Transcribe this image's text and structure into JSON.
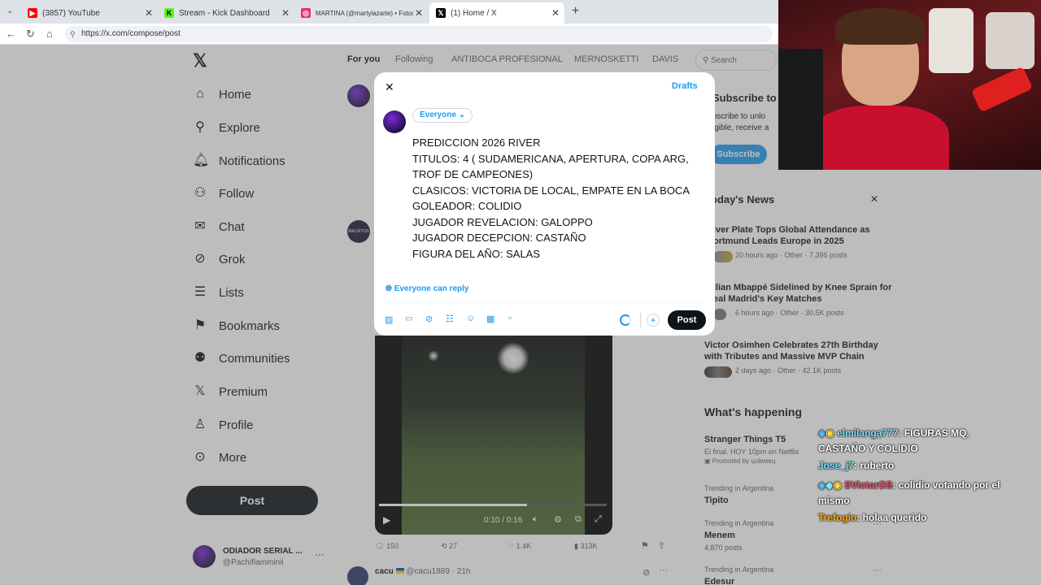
{
  "browser": {
    "tabs": [
      {
        "label": "(3857) YouTube",
        "icon": "youtube-icon",
        "color": "#ff0000"
      },
      {
        "label": "Stream - Kick Dashboard",
        "icon": "kick-icon",
        "color": "#53fc18"
      },
      {
        "label": "MARTINA (@martylazarte) • Fotos y",
        "icon": "instagram-icon",
        "color": "#e1306c"
      },
      {
        "label": "(1) Home / X",
        "icon": "x-icon",
        "color": "#000000"
      }
    ],
    "url": "https://x.com/compose/post"
  },
  "sidebar": {
    "items": [
      {
        "label": "Home",
        "icon": "home-icon"
      },
      {
        "label": "Explore",
        "icon": "search-icon"
      },
      {
        "label": "Notifications",
        "icon": "bell-icon"
      },
      {
        "label": "Follow",
        "icon": "follow-icon"
      },
      {
        "label": "Chat",
        "icon": "mail-icon"
      },
      {
        "label": "Grok",
        "icon": "grok-icon"
      },
      {
        "label": "Lists",
        "icon": "list-icon"
      },
      {
        "label": "Bookmarks",
        "icon": "bookmark-icon"
      },
      {
        "label": "Communities",
        "icon": "communities-icon"
      },
      {
        "label": "Premium",
        "icon": "x-icon"
      },
      {
        "label": "Profile",
        "icon": "person-icon"
      },
      {
        "label": "More",
        "icon": "more-icon"
      }
    ],
    "post_label": "Post",
    "account": {
      "name": "ODIADOR SERIAL ...",
      "handle": "@Pachiflamminii"
    }
  },
  "timeline": {
    "tabs": [
      "For you",
      "Following",
      "ANTIBOCA PROFESIONAL",
      "MERNOSKETTI",
      "DAVIS"
    ],
    "search_placeholder": "Search",
    "video_time": "0:10 / 0:16",
    "stats": {
      "replies": "150",
      "reposts": "27",
      "likes": "1.4K",
      "views": "313K"
    },
    "next_post": {
      "name": "cacu",
      "handle": "@cacu1889 · 21h"
    }
  },
  "modal": {
    "drafts_label": "Drafts",
    "audience_label": "Everyone",
    "lines": [
      "PREDICCION 2026 RIVER",
      "TITULOS: 4 ( SUDAMERICANA, APERTURA, COPA ARG,",
      "TROF DE CAMPEONES)",
      "CLASICOS: VICTORIA DE LOCAL, EMPATE EN LA BOCA",
      "GOLEADOR: COLIDIO",
      "JUGADOR REVELACION: GALOPPO",
      "JUGADOR DECEPCION: CASTAÑO",
      "FIGURA DEL AÑO: SALAS"
    ],
    "reply_label": "Everyone can reply",
    "post_label": "Post"
  },
  "right": {
    "subscribe_title": "Subscribe to",
    "subscribe_text1": "bscribe to unlo",
    "subscribe_text2": "igible, receive a",
    "subscribe_btn": "Subscribe",
    "news_header": "oday's News",
    "news": [
      {
        "title1": "iver Plate Tops Global Attendance as",
        "title2": "ortmund Leads Europe in 2025",
        "meta": "20 hours ago · Other · 7,395 posts"
      },
      {
        "title1": "ilian Mbappé Sidelined by Knee Sprain for",
        "title2": "eal Madrid's Key Matches",
        "meta": "6 hours ago · Other · 30.5K posts"
      },
      {
        "title1": "Victor Osimhen Celebrates 27th Birthday",
        "title2": "with Tributes and Massive MVP Chain",
        "meta": "2 days ago · Other · 42.1K posts"
      }
    ],
    "happening_header": "What's happening",
    "trends": [
      {
        "context": "",
        "title": "Stranger Things T5",
        "sub": "El final. HOY 10pm en Netflix",
        "extra": "Promoted by ɥɔʇɐʍɐɥ"
      },
      {
        "context": "Trending in Argentina",
        "title": "Tipito",
        "sub": "",
        "extra": ""
      },
      {
        "context": "Trending in Argentina",
        "title": "Menem",
        "sub": "4,870 posts",
        "extra": ""
      },
      {
        "context": "Trending in Argentina",
        "title": "Edesur",
        "sub": "",
        "extra": ""
      }
    ]
  },
  "chat": [
    {
      "user": "elmilanga777",
      "color": "#7ee3ff",
      "msg": ": FIGURAS MQ,",
      "msg2": "CASTAÑO Y COLIDIO"
    },
    {
      "user": "Jose_j7",
      "color": "#7ee3ff",
      "msg": ": ruberto",
      "msg2": ""
    },
    {
      "user": "SVictorGS",
      "color": "#ff4d6d",
      "msg": ": colidio votando por el",
      "msg2": "mismo"
    },
    {
      "user": "Trefogio",
      "color": "#ffb020",
      "msg": ": holaa querido",
      "msg2": ""
    }
  ]
}
